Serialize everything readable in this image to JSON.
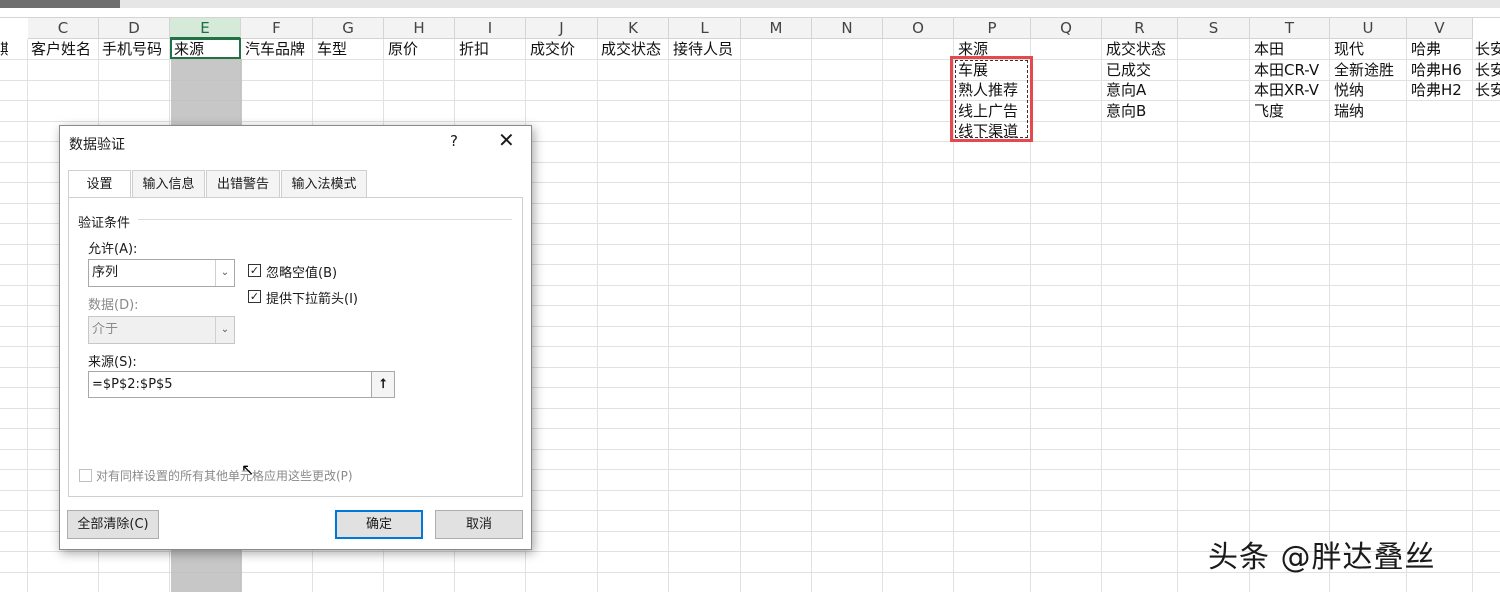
{
  "columns": [
    "C",
    "D",
    "E",
    "F",
    "G",
    "H",
    "I",
    "J",
    "K",
    "L",
    "M",
    "N",
    "O",
    "P",
    "Q",
    "R",
    "S",
    "T",
    "U",
    "V"
  ],
  "selected_column": "E",
  "header_row": {
    "B_partial": "期",
    "C": "客户姓名",
    "D": "手机号码",
    "E": "来源",
    "F": "汽车品牌",
    "G": "车型",
    "H": "原价",
    "I": "折扣",
    "J": "成交价",
    "K": "成交状态",
    "L": "接待人员"
  },
  "lists": {
    "source": [
      "来源",
      "车展",
      "熟人推荐",
      "线上广告",
      "线下渠道"
    ],
    "deal_status": [
      "成交状态",
      "已成交",
      "意向A",
      "意向B"
    ],
    "honda": [
      "本田",
      "本田CR-V",
      "本田XR-V",
      "飞度"
    ],
    "hyundai": [
      "现代",
      "全新途胜",
      "悦纳",
      "瑞纳"
    ],
    "haval": [
      "哈弗",
      "哈弗H6",
      "哈弗H2"
    ],
    "changan": [
      "长安",
      "长安",
      "长安"
    ]
  },
  "dialog": {
    "title": "数据验证",
    "help": "?",
    "close": "✕",
    "tabs": [
      "设置",
      "输入信息",
      "出错警告",
      "输入法模式"
    ],
    "group_label": "验证条件",
    "allow_label": "允许(A):",
    "allow_value": "序列",
    "ignore_blank_label": "忽略空值(B)",
    "ignore_blank_checked": true,
    "dropdown_label": "提供下拉箭头(I)",
    "dropdown_checked": true,
    "data_label": "数据(D):",
    "data_value": "介于",
    "source_label": "来源(S):",
    "source_value": "=$P$2:$P$5",
    "apply_all_label": "对有同样设置的所有其他单元格应用这些更改(P)",
    "clear_all": "全部清除(C)",
    "ok": "确定",
    "cancel": "取消"
  },
  "watermark": "头条 @胖达叠丝",
  "colors": {
    "accent_green": "#217346",
    "highlight_red": "#e5484d",
    "button_blue": "#0078d7"
  }
}
